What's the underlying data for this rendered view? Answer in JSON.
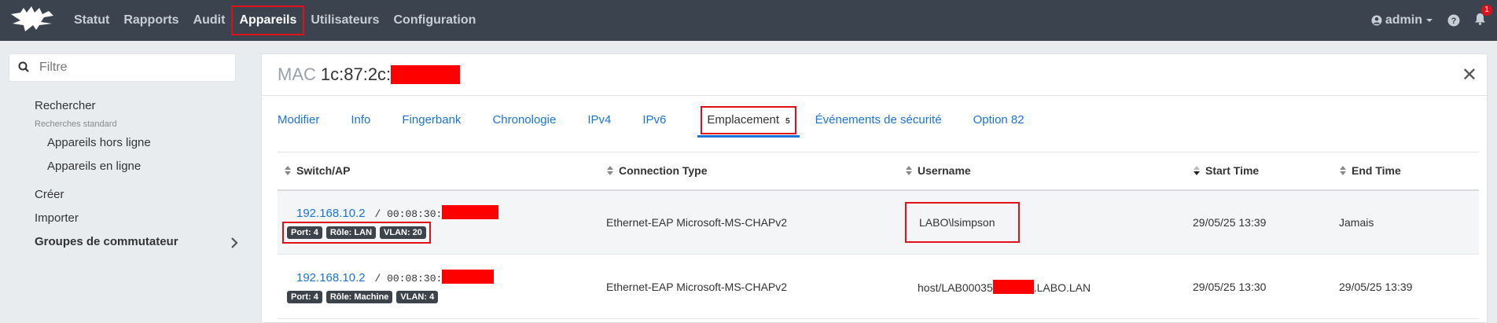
{
  "nav": {
    "links": [
      "Statut",
      "Rapports",
      "Audit",
      "Appareils",
      "Utilisateurs",
      "Configuration"
    ],
    "active": "Appareils",
    "user": "admin",
    "notifications": "1",
    "icons": [
      "logo",
      "user-icon",
      "help-icon",
      "bell-icon"
    ]
  },
  "sidebar": {
    "filter_placeholder": "Filtre",
    "search": "Rechercher",
    "standard_label": "Recherches standard",
    "offline": "Appareils hors ligne",
    "online": "Appareils en ligne",
    "create": "Créer",
    "import": "Importer",
    "switch_groups": "Groupes de commutateur"
  },
  "panel": {
    "mac_prefix": "MAC",
    "mac_visible": "1c:87:2c:",
    "tabs": [
      "Modifier",
      "Info",
      "Fingerbank",
      "Chronologie",
      "IPv4",
      "IPv6",
      "Emplacement",
      "Événements de sécurité",
      "Option 82"
    ],
    "active_tab": "Emplacement",
    "active_tab_count": "5",
    "columns": [
      "Switch/AP",
      "Connection Type",
      "Username",
      "Start Time",
      "End Time"
    ],
    "rows": [
      {
        "ip": "192.168.10.2",
        "mac_prefix": "/ 00:08:30:",
        "port": "Port: 4",
        "role": "Rôle: LAN",
        "vlan": "VLAN: 20",
        "connection": "Ethernet-EAP Microsoft-MS-CHAPv2",
        "username": "LABO\\lsimpson",
        "start": "29/05/25 13:39",
        "end": "Jamais"
      },
      {
        "ip": "192.168.10.2",
        "mac_prefix": "/ 00:08:30:",
        "port": "Port: 4",
        "role": "Rôle: Machine",
        "vlan": "VLAN: 4",
        "connection": "Ethernet-EAP Microsoft-MS-CHAPv2",
        "username_a": "host/LAB00035",
        "username_b": ".LABO.LAN",
        "start": "29/05/25 13:30",
        "end": "29/05/25 13:39"
      }
    ]
  },
  "colors": {
    "navbar": "#3b434e",
    "accent": "#1a73d8",
    "highlight": "#e0101b",
    "redaction": "#ff0000"
  }
}
